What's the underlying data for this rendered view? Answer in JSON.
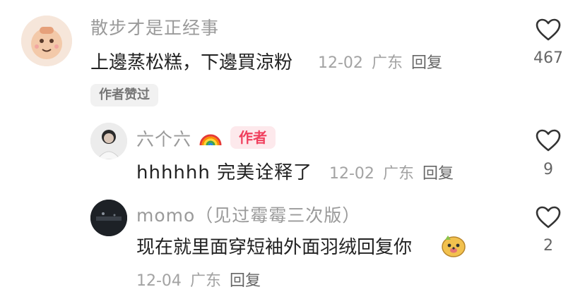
{
  "comment": {
    "username": "散步才是正经事",
    "text": "上邊蒸松糕，下邊買涼粉",
    "date": "12-02",
    "location": "广东",
    "reply_label": "回复",
    "liked_badge": "作者赞过",
    "likes": "467"
  },
  "replies": [
    {
      "username": "六个六",
      "author_tag": "作者",
      "text": "hhhhhh 完美诠释了",
      "date": "12-02",
      "location": "广东",
      "reply_label": "回复",
      "likes": "9"
    },
    {
      "username": "momo（见过霉霉三次版）",
      "text": "现在就里面穿短袖外面羽绒回复你",
      "date": "12-04",
      "location": "广东",
      "reply_label": "回复",
      "likes": "2"
    }
  ],
  "icons": {
    "like": "heart-outline-icon",
    "rainbow": "rainbow-emoji-icon",
    "emoji": "dog-face-emoji-icon"
  },
  "colors": {
    "author_tag_bg": "#fde9ec",
    "author_tag_text": "#f0405e",
    "username": "#9a9a9a",
    "meta": "#a3a3a3"
  }
}
